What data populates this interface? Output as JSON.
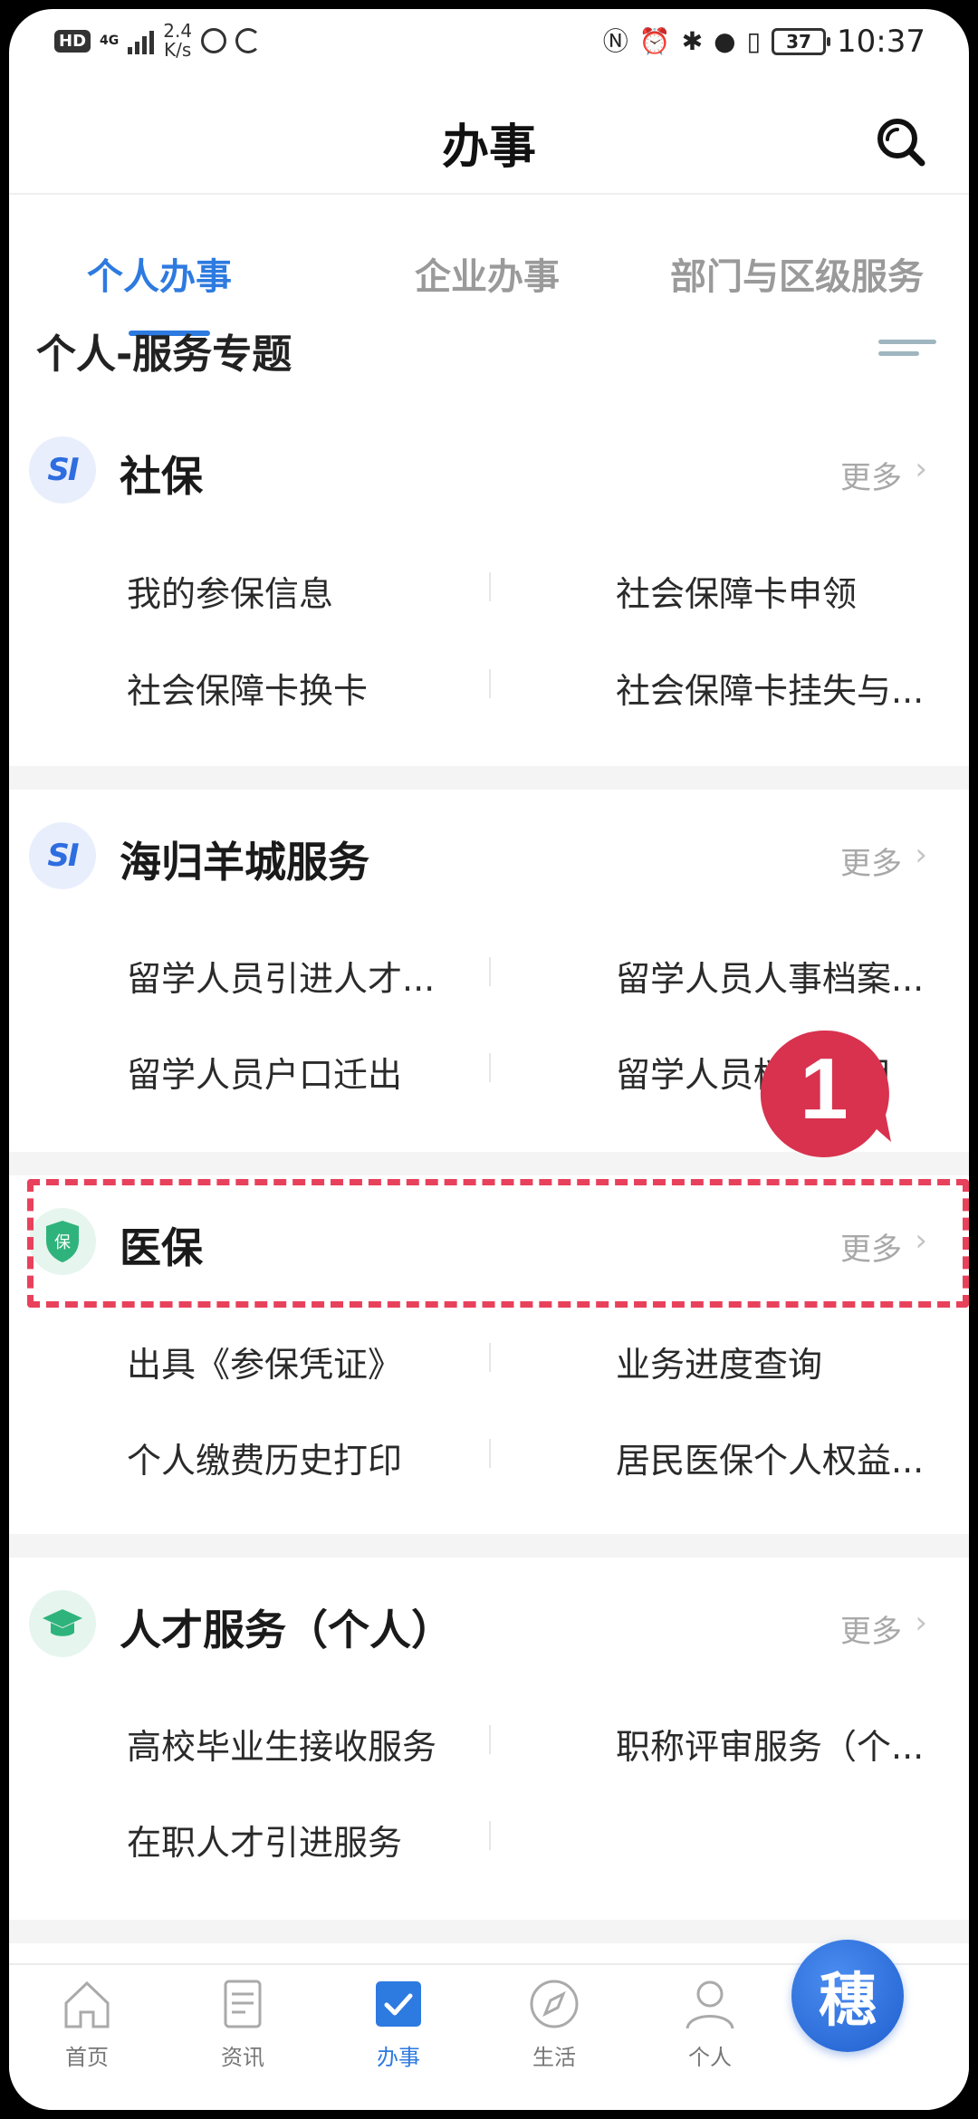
{
  "status_bar": {
    "hd": "HD",
    "network": "4G",
    "speed_value": "2.4",
    "speed_unit": "K/s",
    "battery": "37",
    "time": "10:37",
    "icons": [
      "nfc-icon",
      "alarm-icon",
      "bluetooth-icon",
      "location-icon",
      "vibrate-icon"
    ]
  },
  "header": {
    "title": "办事",
    "search_icon": "search-icon"
  },
  "tabs": [
    {
      "label": "个人办事",
      "active": true
    },
    {
      "label": "企业办事",
      "active": false
    },
    {
      "label": "部门与区级服务",
      "active": false
    }
  ],
  "section": {
    "title": "个人-服务专题"
  },
  "cards": [
    {
      "title": "社保",
      "icon": "si-logo",
      "more": "更多",
      "items": [
        "我的参保信息",
        "社会保障卡申领",
        "社会保障卡换卡",
        "社会保障卡挂失与..."
      ]
    },
    {
      "title": "海归羊城服务",
      "icon": "si-logo",
      "more": "更多",
      "items": [
        "留学人员引进人才...",
        "留学人员人事档案...",
        "留学人员户口迁出",
        "留学人员档案借用"
      ]
    },
    {
      "title": "医保",
      "icon": "shield-icon",
      "icon_text": "保",
      "more": "更多",
      "items": [
        "出具《参保凭证》",
        "业务进度查询",
        "个人缴费历史打印",
        "居民医保个人权益..."
      ]
    },
    {
      "title": "人才服务（个人）",
      "icon": "graduation-cap-icon",
      "more": "更多",
      "items": [
        "高校毕业生接收服务",
        "职称评审服务（个...",
        "在职人才引进服务"
      ]
    }
  ],
  "si_logo_text": "SI",
  "annotation": {
    "number": "1",
    "color": "#e8415c"
  },
  "bottom_nav": [
    {
      "label": "首页",
      "icon": "home-icon",
      "active": false
    },
    {
      "label": "资讯",
      "icon": "news-icon",
      "active": false
    },
    {
      "label": "办事",
      "icon": "checkbox-icon",
      "active": true
    },
    {
      "label": "生活",
      "icon": "compass-icon",
      "active": false
    },
    {
      "label": "个人",
      "icon": "person-icon",
      "active": false
    }
  ],
  "fab": {
    "label": "穗",
    "icon": "sui-logo-icon"
  },
  "colors": {
    "accent": "#2d7ae0",
    "highlight": "#e8415c",
    "gap": "#f4f4f4"
  }
}
